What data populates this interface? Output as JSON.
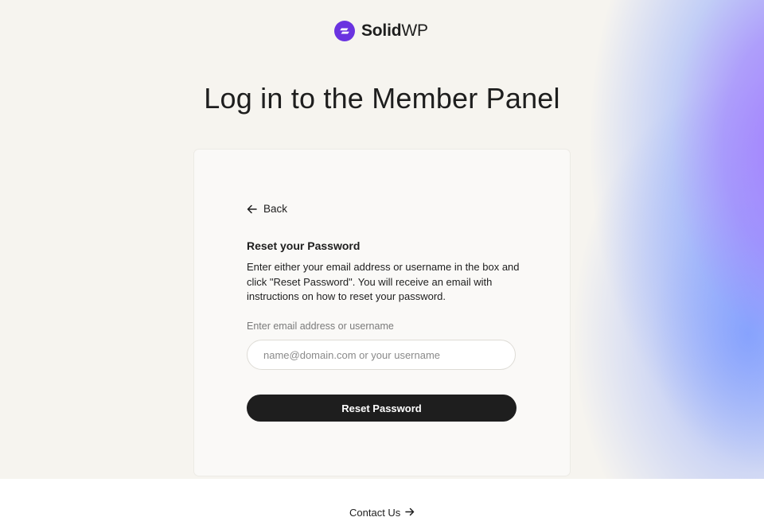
{
  "brand": {
    "name_bold": "Solid",
    "name_regular": "WP",
    "accent_color": "#6a33e0"
  },
  "page": {
    "title": "Log in to the Member Panel"
  },
  "card": {
    "back_label": "Back",
    "reset_title": "Reset your Password",
    "reset_description": "Enter either your email address or username in the box and click \"Reset Password\". You will receive an email with instructions on how to reset your password.",
    "field_label": "Enter email address or username",
    "field_placeholder": "name@domain.com or your username",
    "field_value": "",
    "submit_label": "Reset Password"
  },
  "footer": {
    "contact_label": "Contact Us"
  },
  "icons": {
    "logo": "solidwp-logo-icon",
    "back": "arrow-left-icon",
    "contact": "arrow-right-icon"
  }
}
